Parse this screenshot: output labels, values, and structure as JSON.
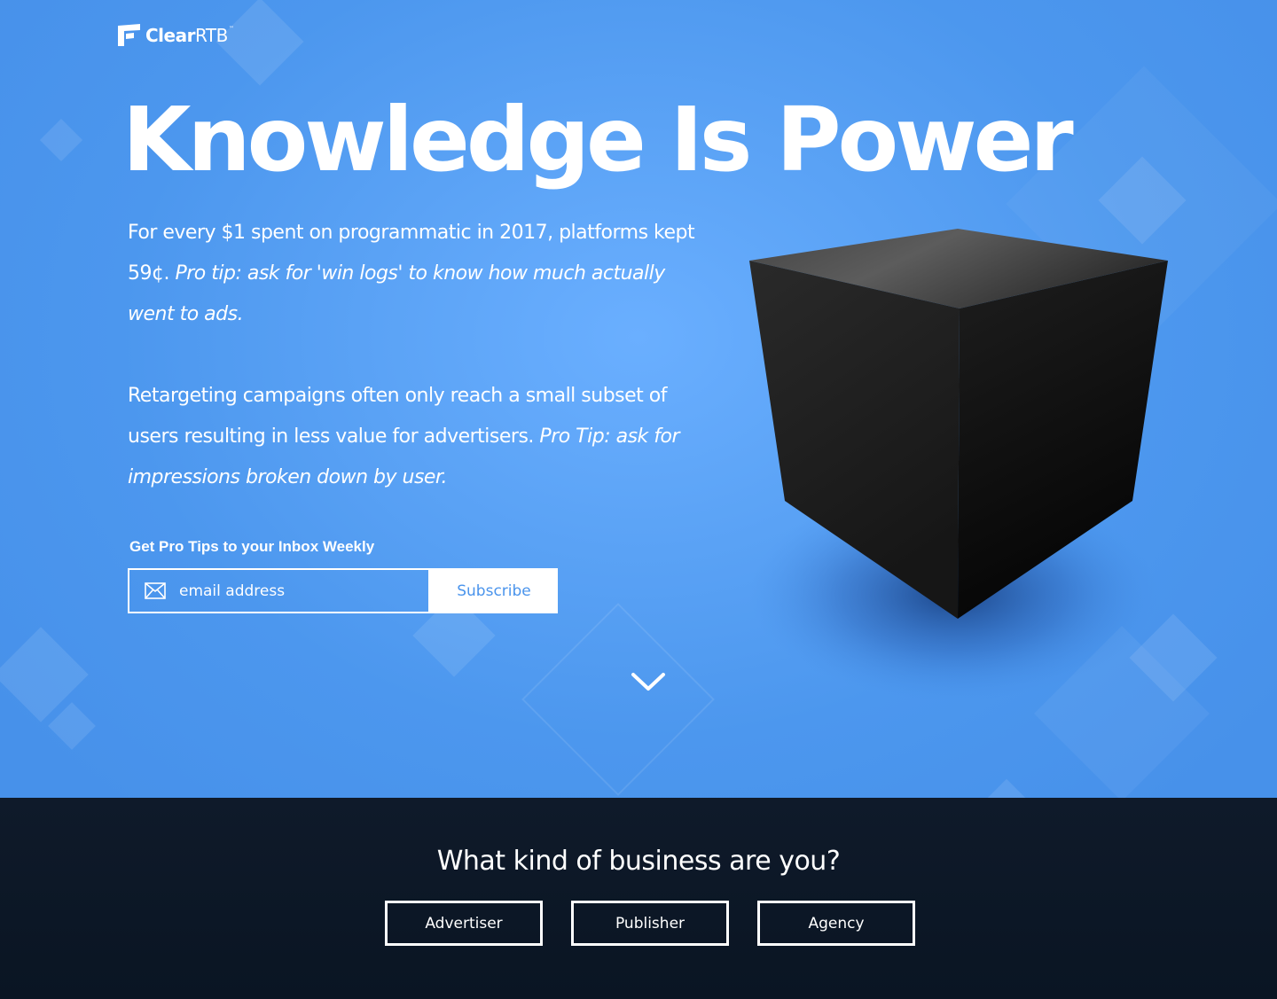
{
  "brand": {
    "logo_main": "Clear",
    "logo_suffix": "RTB",
    "logo_tm": "™"
  },
  "hero": {
    "headline": "Knowledge Is Power",
    "paragraph_1": {
      "text": "For every $1 spent on programmatic in 2017, platforms kept 59¢.",
      "tip": "Pro tip: ask for 'win logs' to know how much actually went to ads."
    },
    "paragraph_2": {
      "text": "Retargeting campaigns often only reach a small subset of users resulting in less value for advertisers.",
      "tip": "Pro Tip: ask for impressions broken down by user."
    },
    "chevron_icon": "chevron-down-icon",
    "cube_icon": "black-box-cube"
  },
  "subscribe": {
    "label": "Get Pro Tips to your Inbox Weekly",
    "email_placeholder": "email address",
    "email_value": "",
    "button_label": "Subscribe",
    "mail_icon": "mail-icon"
  },
  "business": {
    "question": "What kind of business are you?",
    "options": [
      "Advertiser",
      "Publisher",
      "Agency"
    ]
  },
  "colors": {
    "hero_blue": "#4c97ee",
    "dark_navy": "#0f1a2a",
    "white": "#ffffff"
  }
}
